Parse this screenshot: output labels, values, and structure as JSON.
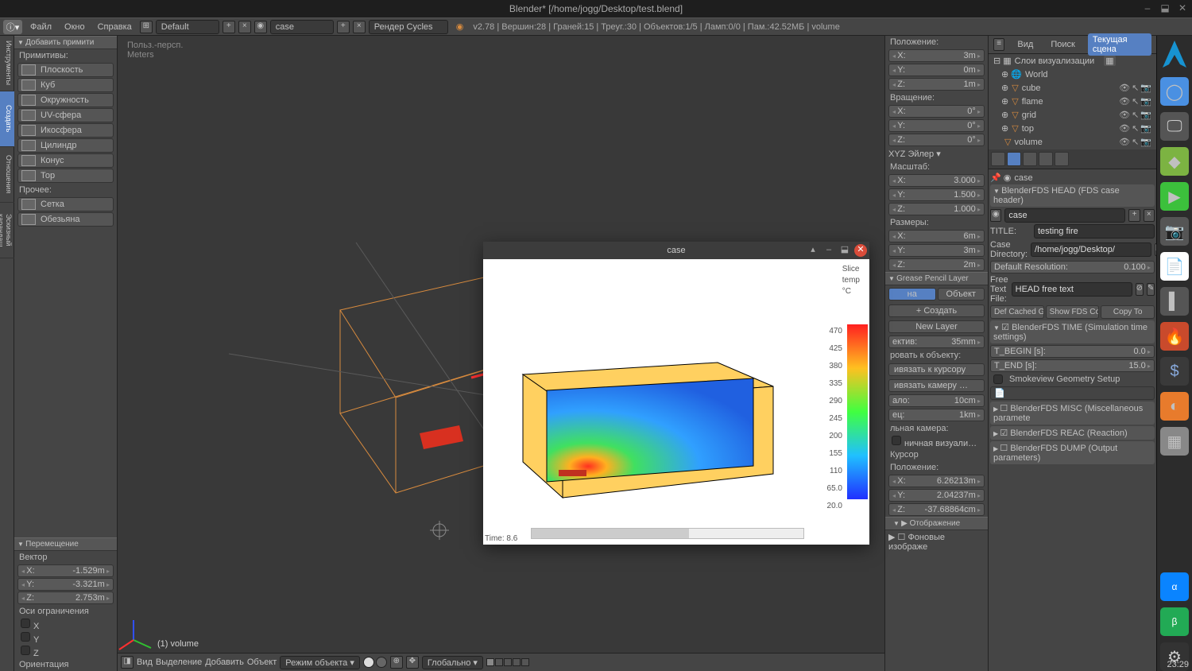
{
  "window_title": "Blender* [/home/jogg/Desktop/test.blend]",
  "menubar": {
    "file": "Файл",
    "window": "Окно",
    "help": "Справка",
    "layout_dd": "Default",
    "scene_dd": "case",
    "render_dd": "Рендер Cycles"
  },
  "info_string": "v2.78 | Вершин:28 | Граней:15 | Треуг.:30 | Объектов:1/5 | Ламп:0/0 | Пам.:42.52МБ | volume",
  "left_tabs": [
    "Инструменты",
    "Создать",
    "Отношения",
    "Эскизный карандаш"
  ],
  "left_panel": {
    "add_prim": "Добавить примити",
    "prims_label": "Примитивы:",
    "prims": [
      "Плоскость",
      "Куб",
      "Окружность",
      "UV-сфера",
      "Икосфера",
      "Цилиндр",
      "Конус",
      "Тор"
    ],
    "other_label": "Прочее:",
    "others": [
      "Сетка",
      "Обезьяна"
    ]
  },
  "viewport": {
    "hud1": "Польз.-персп.",
    "hud2": "Meters",
    "objlabel": "(1) volume",
    "footer": {
      "view": "Вид",
      "select": "Выделение",
      "add": "Добавить",
      "object": "Объект",
      "mode": "Режим объекта",
      "orient": "Глобально"
    },
    "translate": {
      "title": "Перемещение",
      "vector": "Вектор",
      "x": "-1.529m",
      "y": "-3.321m",
      "z": "2.753m",
      "axis": "Оси ограничения",
      "ax": "X",
      "ay": "Y",
      "az": "Z",
      "orient": "Ориентация"
    }
  },
  "npanel": {
    "pos": "Положение:",
    "px": "3m",
    "py": "0m",
    "pz": "1m",
    "rot": "Вращение:",
    "rx": "0°",
    "ry": "0°",
    "rz": "0°",
    "rmode": "XYZ Эйлер",
    "scale": "Масштаб:",
    "sx": "3.000",
    "sy": "1.500",
    "sz": "1.000",
    "dim": "Размеры:",
    "dx": "6m",
    "dy": "3m",
    "dz": "2m",
    "gp": "Grease Pencil Layer",
    "new": "Создать",
    "newlayer": "New Layer",
    "scene": "на",
    "object": "Объект",
    "lens": "ектив:",
    "lensval": "35mm",
    "lockto": "ровать к объекту:",
    "tocursor": "ивязать к курсору",
    "tocam": "ивязать камеру …",
    "clipstart": "ало:",
    "clipstartval": "10cm",
    "clipend": "ец:",
    "clipendval": "1km",
    "localcam": "льная камера:",
    "limvis": "ничная визуали…",
    "cursor": "Курсор",
    "cursor_pos": "Положение:",
    "cx": "6.26213m",
    "cy": "2.04237m",
    "cz": "-37.68864cm",
    "display": "Отображение",
    "bgimg": "Фоновые изображе"
  },
  "outliner": {
    "tabs": {
      "view": "Вид",
      "search": "Поиск",
      "scene": "Текущая сцена"
    },
    "vislayers": "Слои визуализации",
    "world": "World",
    "items": [
      "cube",
      "flame",
      "grid",
      "top",
      "volume"
    ]
  },
  "props": {
    "breadcrumb": "case",
    "head": "BlenderFDS HEAD (FDS case header)",
    "name": "case",
    "title_lab": "TITLE:",
    "title_val": "testing fire",
    "dir_lab": "Case Directory:",
    "dir_val": "/home/jogg/Desktop/",
    "res_lab": "Default Resolution:",
    "res_val": "0.100",
    "ftf_lab": "Free Text File:",
    "ftf_val": "HEAD free text",
    "btn1": "Def Cached G…",
    "btn2": "Show FDS Code",
    "btn3": "Copy To",
    "time": "BlenderFDS TIME (Simulation time settings)",
    "tbegin": "T_BEGIN [s]:",
    "tbegin_v": "0.0",
    "tend": "T_END [s]:",
    "tend_v": "15.0",
    "smv": "Smokeview Geometry Setup",
    "misc": "BlenderFDS MISC (Miscellaneous paramete",
    "reac": "BlenderFDS REAC (Reaction)",
    "dump": "BlenderFDS DUMP (Output parameters)"
  },
  "popup": {
    "title": "case",
    "slice": "Slice",
    "temp": "temp",
    "unit": "°C",
    "ticks": [
      "470",
      "425",
      "380",
      "335",
      "290",
      "245",
      "200",
      "155",
      "110",
      "65.0",
      "20.0"
    ],
    "time": "Time: 8.6"
  },
  "clock": "23:29",
  "chart_data": {
    "type": "heatmap",
    "title": "Slice temp °C",
    "colorbar_range": [
      20.0,
      470
    ],
    "colorbar_ticks": [
      470,
      425,
      380,
      335,
      290,
      245,
      200,
      155,
      110,
      65.0,
      20.0
    ],
    "time": 8.6
  }
}
